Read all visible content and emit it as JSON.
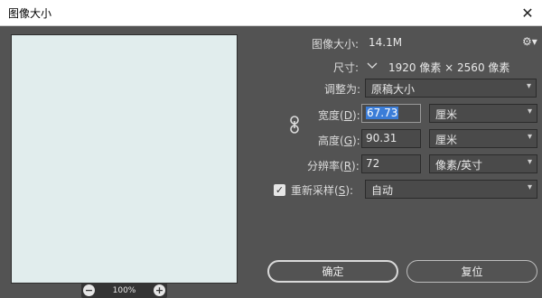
{
  "window": {
    "title": "图像大小",
    "close_icon": "close-icon"
  },
  "preview": {
    "zoom": "100%",
    "zoom_out_icon": "minus-circle-icon",
    "zoom_in_icon": "plus-circle-icon"
  },
  "info": {
    "size_label": "图像大小:",
    "size_value": "14.1M",
    "dims_label": "尺寸:",
    "dims_value": "1920 像素 × 2560 像素",
    "dims_toggle_icon": "chevron-down-icon"
  },
  "fit": {
    "label": "调整为:",
    "value": "原稿大小"
  },
  "width": {
    "label": "宽度(",
    "key": "D",
    "suffix": "):",
    "value": "67.73",
    "unit": "厘米"
  },
  "height": {
    "label": "高度(",
    "key": "G",
    "suffix": "):",
    "value": "90.31",
    "unit": "厘米"
  },
  "resolution": {
    "label": "分辨率(",
    "key": "R",
    "suffix": "):",
    "value": "72",
    "unit": "像素/英寸"
  },
  "resample": {
    "label": "重新采样(",
    "key": "S",
    "suffix": "):",
    "checked": true,
    "value": "自动"
  },
  "buttons": {
    "ok": "确定",
    "reset": "复位"
  },
  "colors": {
    "panel": "#535353",
    "preview": "#e1eded",
    "selection": "#3b7dd8"
  }
}
